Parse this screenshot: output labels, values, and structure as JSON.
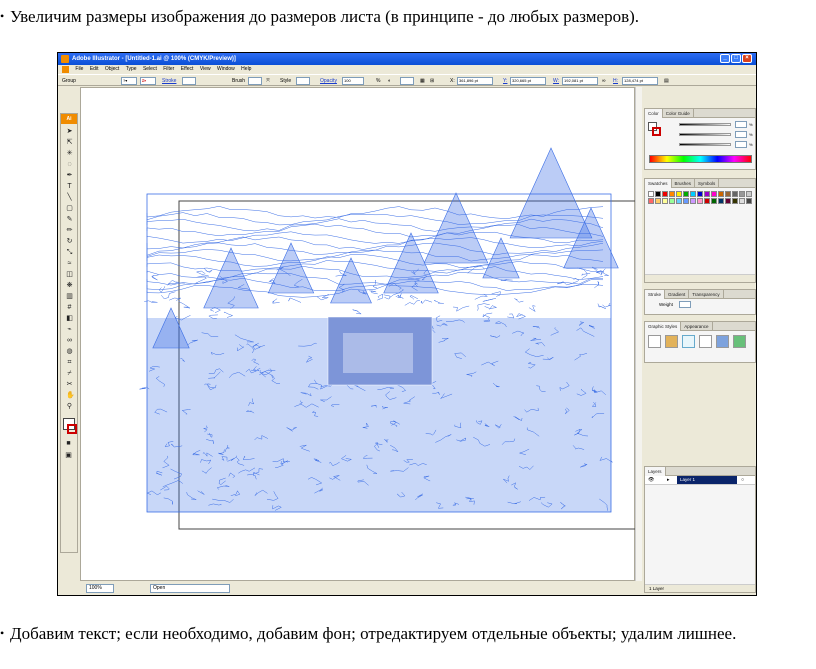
{
  "doc_text": {
    "bullet": "•",
    "para1": "Увеличим размеры изображения до размеров листа (в принципе - до любых размеров).",
    "para2": "Добавим текст; если необходимо, добавим фон; отредактируем отдельные объекты; удалим лишнее."
  },
  "app": {
    "title": "Adobe Illustrator - [Untitled-1.ai @ 100% (CMYK/Preview)]",
    "menu": [
      "File",
      "Edit",
      "Object",
      "Type",
      "Select",
      "Filter",
      "Effect",
      "View",
      "Window",
      "Help"
    ],
    "control": {
      "selection": "Group",
      "stroke_label": "Stroke",
      "brush_label": "Brush",
      "style_label": "Style",
      "opacity_label": "Opacity",
      "opacity_value": "100",
      "percent": "%",
      "x_label": "X:",
      "x_value": "361,896 pt",
      "y_label": "Y:",
      "y_value": "320,665 pt",
      "w_label": "W:",
      "w_value": "192,081 pt",
      "h_label": "H:",
      "h_value": "128,474 pt"
    },
    "tools_header": "Ai",
    "status": {
      "zoom": "100%",
      "mode": "Open"
    },
    "panels": {
      "color": {
        "tabs": [
          "Color",
          "Color Guide"
        ],
        "percent": "%"
      },
      "swatches": {
        "tabs": [
          "Swatches",
          "Brushes",
          "Symbols"
        ]
      },
      "stroke": {
        "tabs": [
          "Stroke",
          "Gradient",
          "Transparency"
        ],
        "weight_label": "Weight"
      },
      "graphic_styles": {
        "tabs": [
          "Graphic Styles",
          "Appearance"
        ]
      },
      "layers": {
        "tabs": [
          "Layers"
        ],
        "layer_name": "Layer 1",
        "count": "1 Layer"
      }
    },
    "colors": {
      "title_bar": "#0a4fd6",
      "accent": "#f08c00",
      "contour": "#3b6ee6",
      "photo": "#7d95d8"
    }
  }
}
